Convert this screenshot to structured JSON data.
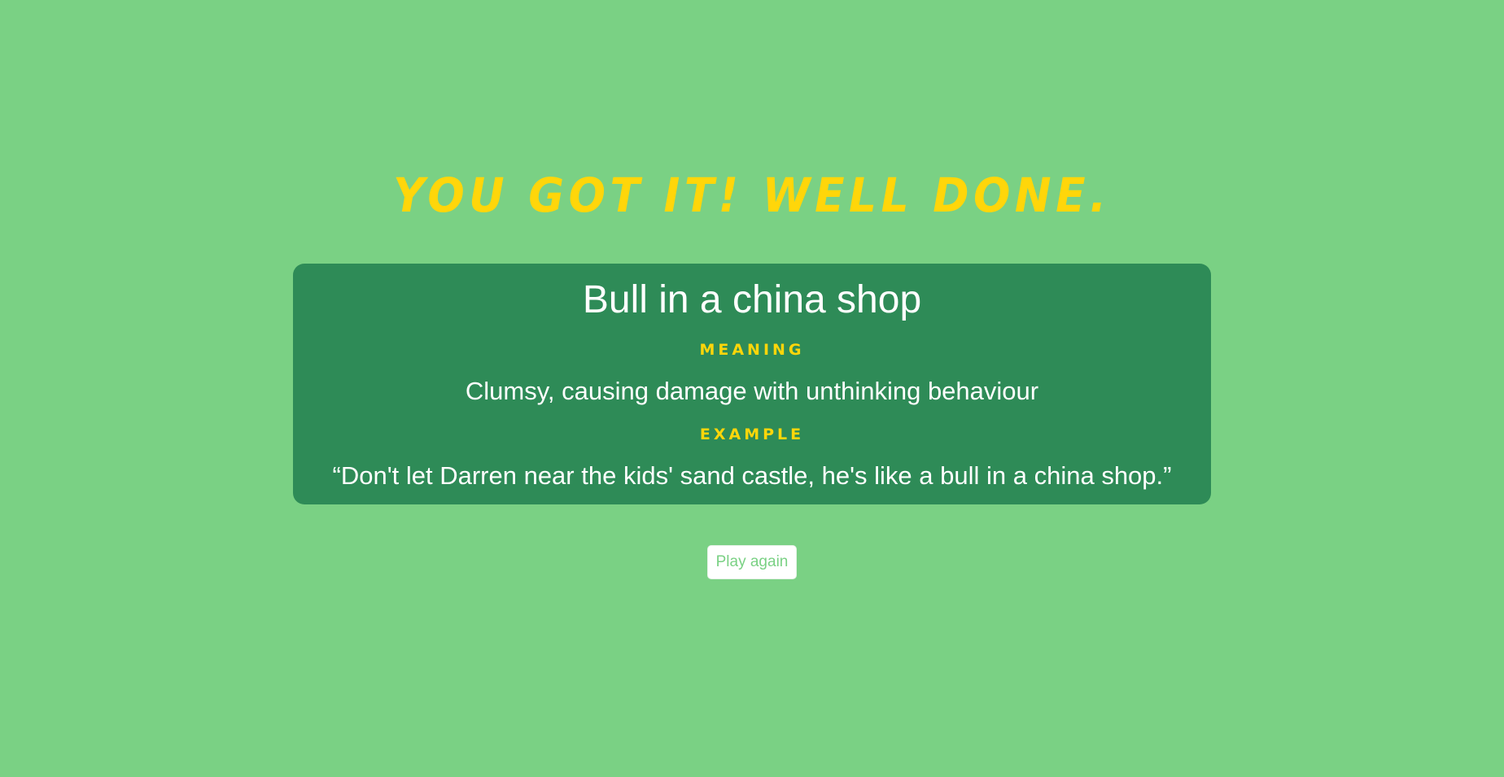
{
  "headline": "You got it! Well done.",
  "card": {
    "idiom": "Bull in a china shop",
    "meaning_label": "Meaning",
    "meaning": "Clumsy, causing damage with unthinking behaviour",
    "example_label": "Example",
    "example": "“Don't let Darren near the kids' sand castle, he's like a bull in a china shop.”"
  },
  "actions": {
    "play_again_label": "Play again"
  },
  "colors": {
    "background": "#7ad184",
    "card": "#2e8b57",
    "accent_yellow": "#ffd60a",
    "text_white": "#ffffff"
  }
}
